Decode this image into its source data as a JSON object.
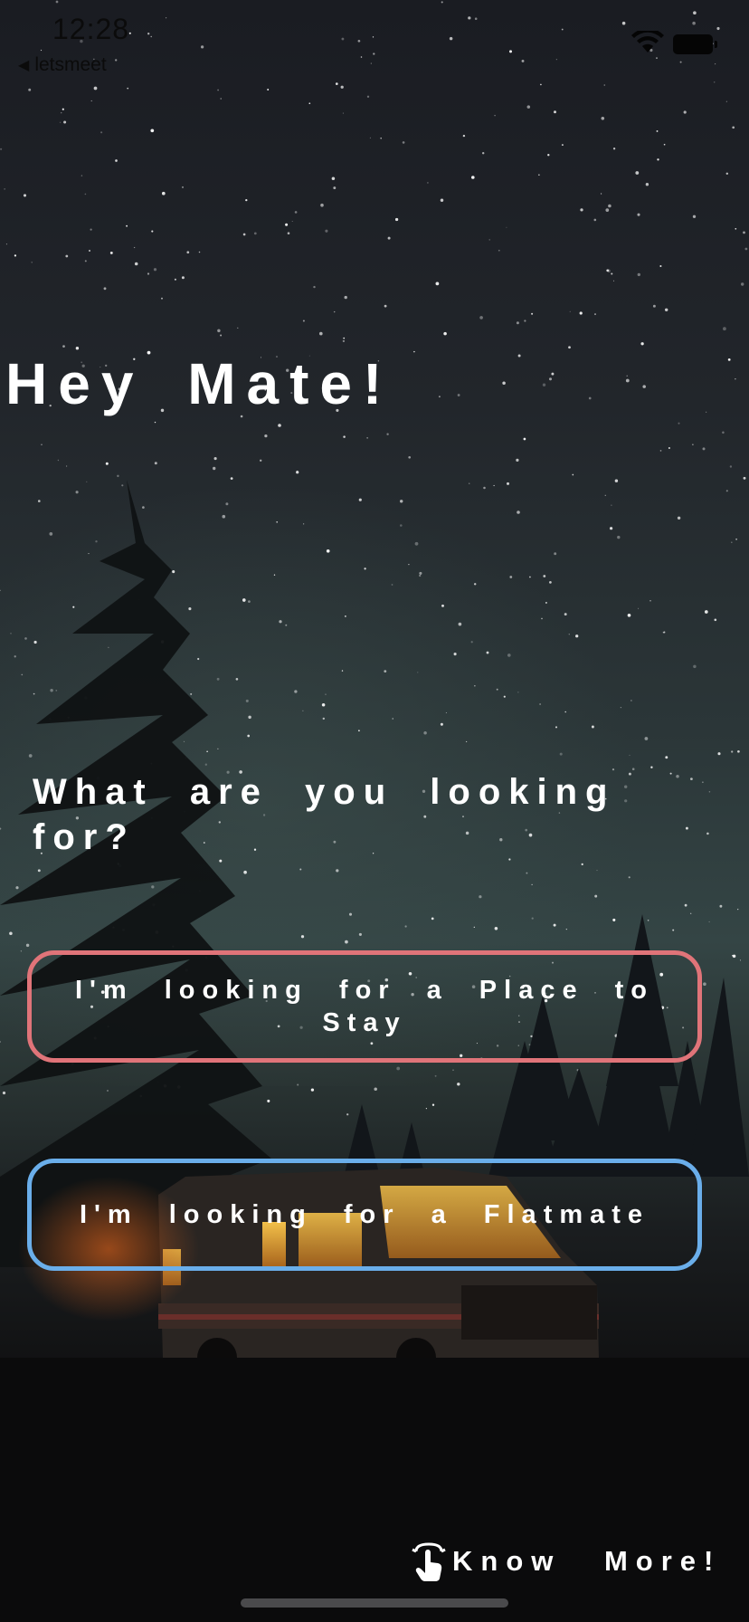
{
  "status_bar": {
    "time": "12:28",
    "back_label": "letsmeet",
    "back_icon": "back-triangle-icon",
    "wifi_icon": "wifi-icon",
    "battery_icon": "battery-icon"
  },
  "hero": {
    "title": "Hey Mate!"
  },
  "prompt": {
    "question": "What are you looking for?"
  },
  "choices": {
    "place": {
      "label": "I'm looking for a Place to Stay",
      "border_color": "#e07479"
    },
    "flatmate": {
      "label": "I'm looking for a Flatmate",
      "border_color": "#6aaeea"
    }
  },
  "footer": {
    "know_more_label": "Know More!",
    "know_more_icon": "tap-hand-icon"
  }
}
